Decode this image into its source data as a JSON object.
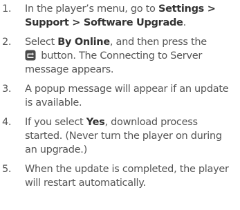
{
  "steps": [
    {
      "number": "1.",
      "text_before": "In the player’s menu, go to ",
      "menu_path": "Settings > Support > Software Upgrade",
      "text_after": "."
    },
    {
      "number": "2.",
      "text_before": "Select ",
      "bold": "By Online",
      "text_middle": ", and then press the",
      "icon": "enter-button-icon",
      "text_after": " button. The Connecting to Server message appears."
    },
    {
      "number": "3.",
      "text": "A popup message will appear if an update is available."
    },
    {
      "number": "4.",
      "text_before": "If you select ",
      "bold": "Yes",
      "text_after": ", download process started. (Never turn the player on during an upgrade.)"
    },
    {
      "number": "5.",
      "text": "When the update is completed, the player will restart automatically."
    }
  ],
  "colors": {
    "text": "#555555",
    "bold_text": "#333333",
    "icon_bg": "#4a4a4a"
  }
}
